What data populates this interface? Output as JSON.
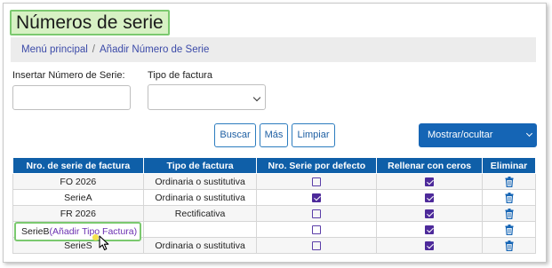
{
  "page": {
    "title": "Números de serie"
  },
  "breadcrumb": {
    "home": "Menú principal",
    "separator": "/",
    "current": "Añadir Número de Serie"
  },
  "filters": {
    "serial_label": "Insertar Número de Serie:",
    "serial_value": "",
    "invoice_type_label": "Tipo de factura",
    "invoice_type_value": ""
  },
  "buttons": {
    "search": "Buscar",
    "more": "Más",
    "clear": "Limpiar",
    "toggle_columns": "Mostrar/ocultar columnas"
  },
  "table": {
    "headers": [
      "Nro. de serie de factura",
      "Tipo de factura",
      "Nro. Serie por defecto",
      "Rellenar con ceros",
      "Eliminar"
    ],
    "rows": [
      {
        "serie": "FO 2026",
        "tipo": "Ordinaria o sustitutiva",
        "defecto": false,
        "ceros": true
      },
      {
        "serie": "SerieA",
        "tipo": "Ordinaria o sustitutiva",
        "defecto": true,
        "ceros": true
      },
      {
        "serie": "FR 2026",
        "tipo": "Rectificativa",
        "defecto": false,
        "ceros": true
      },
      {
        "serie": "SerieB",
        "tipo": "",
        "defecto": false,
        "ceros": true
      },
      {
        "serie": "SerieS",
        "tipo": "Ordinaria o sustitutiva",
        "defecto": false,
        "ceros": true
      }
    ],
    "add_type_link": "(Añadir Tipo Factura)"
  },
  "colors": {
    "header_bg": "#0f5fa8",
    "accent_green": "#7bc96f",
    "checkbox_purple": "#4d2a9a"
  }
}
